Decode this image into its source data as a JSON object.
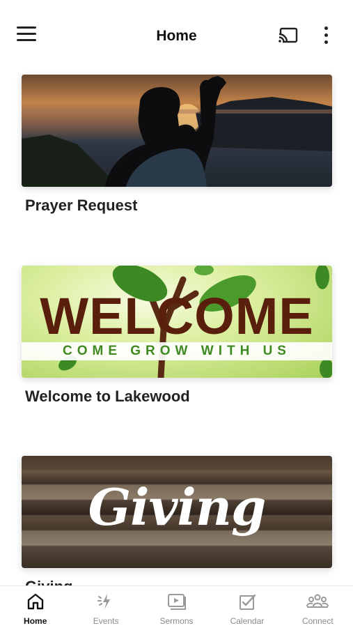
{
  "header": {
    "title": "Home",
    "menu_icon": "hamburger-menu-icon",
    "cast_icon": "cast-icon",
    "more_icon": "more-vertical-icon"
  },
  "cards": [
    {
      "label": "Prayer Request",
      "image": "person raising hand at sunset photo"
    },
    {
      "label": "Welcome to Lakewood",
      "image_title": "WELCOME",
      "image_subtitle": "COME GROW WITH US"
    },
    {
      "label": "Giving",
      "image_title": "Giving"
    }
  ],
  "tabs": [
    {
      "label": "Home",
      "icon": "home-icon",
      "active": true
    },
    {
      "label": "Events",
      "icon": "events-icon",
      "active": false
    },
    {
      "label": "Sermons",
      "icon": "sermons-icon",
      "active": false
    },
    {
      "label": "Calendar",
      "icon": "calendar-icon",
      "active": false
    },
    {
      "label": "Connect",
      "icon": "connect-icon",
      "active": false
    }
  ],
  "colors": {
    "active_tab": "#111111",
    "inactive_tab": "#8a8a8a",
    "welcome_title": "#5a1f0c",
    "welcome_subtitle": "#3f8a20"
  }
}
